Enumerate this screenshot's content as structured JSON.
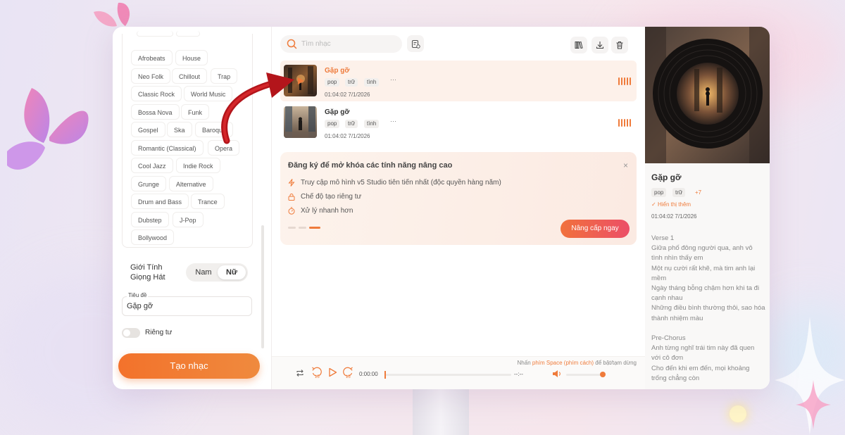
{
  "genres": [
    "Afrobeats",
    "House",
    "Neo Folk",
    "Chillout",
    "Trap",
    "Classic Rock",
    "World Music",
    "Bossa Nova",
    "Funk",
    "Gospel",
    "Ska",
    "Baroque",
    "Romantic (Classical)",
    "Opera",
    "Cool Jazz",
    "Indie Rock",
    "Grunge",
    "Alternative",
    "Drum and Bass",
    "Trance",
    "Dubstep",
    "J-Pop",
    "Bollywood"
  ],
  "vocal_gender": {
    "label_line1": "Giới Tính",
    "label_line2": "Giọng Hát",
    "male": "Nam",
    "female": "Nữ",
    "selected": "Nữ"
  },
  "title_field": {
    "label": "Tiêu đề",
    "value": "Gặp gỡ"
  },
  "private_toggle": {
    "label": "Riêng tư",
    "on": false
  },
  "create_button": "Tạo nhạc",
  "search": {
    "placeholder": "Tìm nhạc"
  },
  "tracks": [
    {
      "title": "Gặp gỡ",
      "tags": [
        "pop",
        "trữ",
        "tình"
      ],
      "more": "···",
      "meta": "01:04:02 7/1/2026",
      "active": true
    },
    {
      "title": "Gặp gỡ",
      "tags": [
        "pop",
        "trữ",
        "tình"
      ],
      "more": "···",
      "meta": "01:04:02 7/1/2026",
      "active": false
    }
  ],
  "promo": {
    "title": "Đăng ký để mở khóa các tính năng nâng cao",
    "features": [
      "Truy cập mô hình v5 Studio tiên tiến nhất (độc quyền hàng năm)",
      "Chế độ tạo riêng tư",
      "Xử lý nhanh hơn"
    ],
    "feature_icons": [
      "bolt-icon",
      "lock-icon",
      "timer-icon"
    ],
    "button": "Nâng cấp ngay",
    "close": "×"
  },
  "player": {
    "hint_prefix": "Nhấn",
    "hint_key": "phím Space (phím cách)",
    "hint_suffix": "để bật/tạm dừng",
    "current_time": "0:00:00",
    "duration": "--:--",
    "rewind_label": "15",
    "forward_label": "15",
    "progress": 0,
    "volume": 1
  },
  "detail": {
    "title": "Gặp gỡ",
    "tags": [
      "pop",
      "trữ"
    ],
    "more_tags": "+7",
    "show_more": "Hiển thị thêm",
    "meta": "01:04:02 7/1/2026",
    "lyrics": "Verse 1\nGiữa phố đông người qua, anh vô tình nhìn thấy em\nMột nụ cười rất khẽ, mà tim anh lại mềm\nNgày tháng bỗng chậm hơn khi ta đi cạnh nhau\nNhững điều bình thường thôi, sao hóa thành nhiệm màu\n\nPre-Chorus\nAnh từng nghĩ trái tim này đã quen với cô đơn\nCho đến khi em đến, mọi khoảng trống chẳng còn"
  },
  "colors": {
    "accent": "#ef7b3b",
    "accent_pink": "#ec4e67",
    "arrow": "#b3151b",
    "butterfly": "#e86aa6"
  }
}
